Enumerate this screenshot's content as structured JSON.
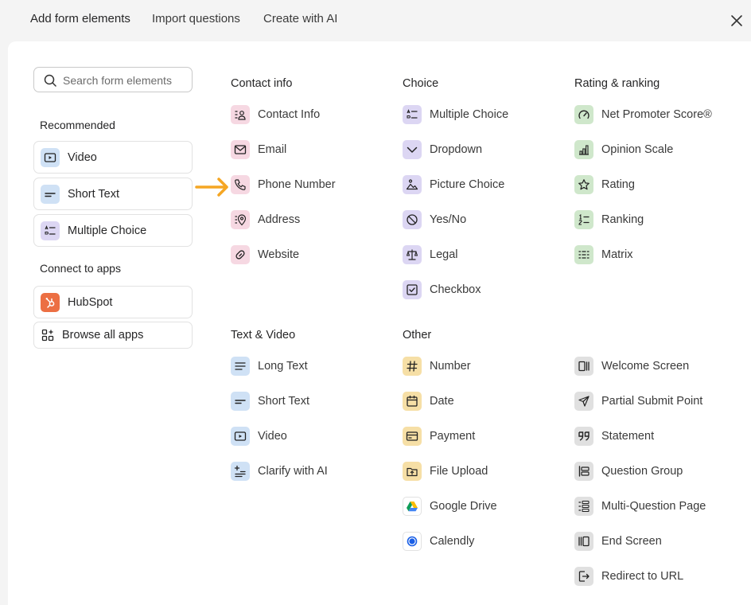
{
  "tabs": [
    "Add form elements",
    "Import questions",
    "Create with AI"
  ],
  "search": {
    "placeholder": "Search form elements"
  },
  "sidebar": {
    "recommended_heading": "Recommended",
    "recommended": [
      "Video",
      "Short Text",
      "Multiple Choice"
    ],
    "apps_heading": "Connect to apps",
    "hubspot": "HubSpot",
    "browse": "Browse all apps"
  },
  "columns": {
    "contact": {
      "title": "Contact info",
      "items": [
        "Contact Info",
        "Email",
        "Phone Number",
        "Address",
        "Website"
      ]
    },
    "choice": {
      "title": "Choice",
      "items": [
        "Multiple Choice",
        "Dropdown",
        "Picture Choice",
        "Yes/No",
        "Legal",
        "Checkbox"
      ]
    },
    "rating": {
      "title": "Rating & ranking",
      "items": [
        "Net Promoter Score®",
        "Opinion Scale",
        "Rating",
        "Ranking",
        "Matrix"
      ]
    },
    "text": {
      "title": "Text & Video",
      "items": [
        "Long Text",
        "Short Text",
        "Video",
        "Clarify with AI"
      ]
    },
    "other": {
      "title": "Other",
      "items": [
        "Number",
        "Date",
        "Payment",
        "File Upload",
        "Google Drive",
        "Calendly"
      ]
    },
    "screens": {
      "items": [
        "Welcome Screen",
        "Partial Submit Point",
        "Statement",
        "Question Group",
        "Multi-Question Page",
        "End Screen",
        "Redirect to URL"
      ]
    }
  },
  "colors": {
    "arrow": "#f5a623",
    "hubspot": "#ec6f43",
    "pink": "#f6d8e2",
    "blue": "#cfe1f5",
    "purple": "#dcd6f3",
    "green": "#cfe7cb",
    "yellow": "#f6dfa6",
    "gray": "#e0e0e0"
  }
}
